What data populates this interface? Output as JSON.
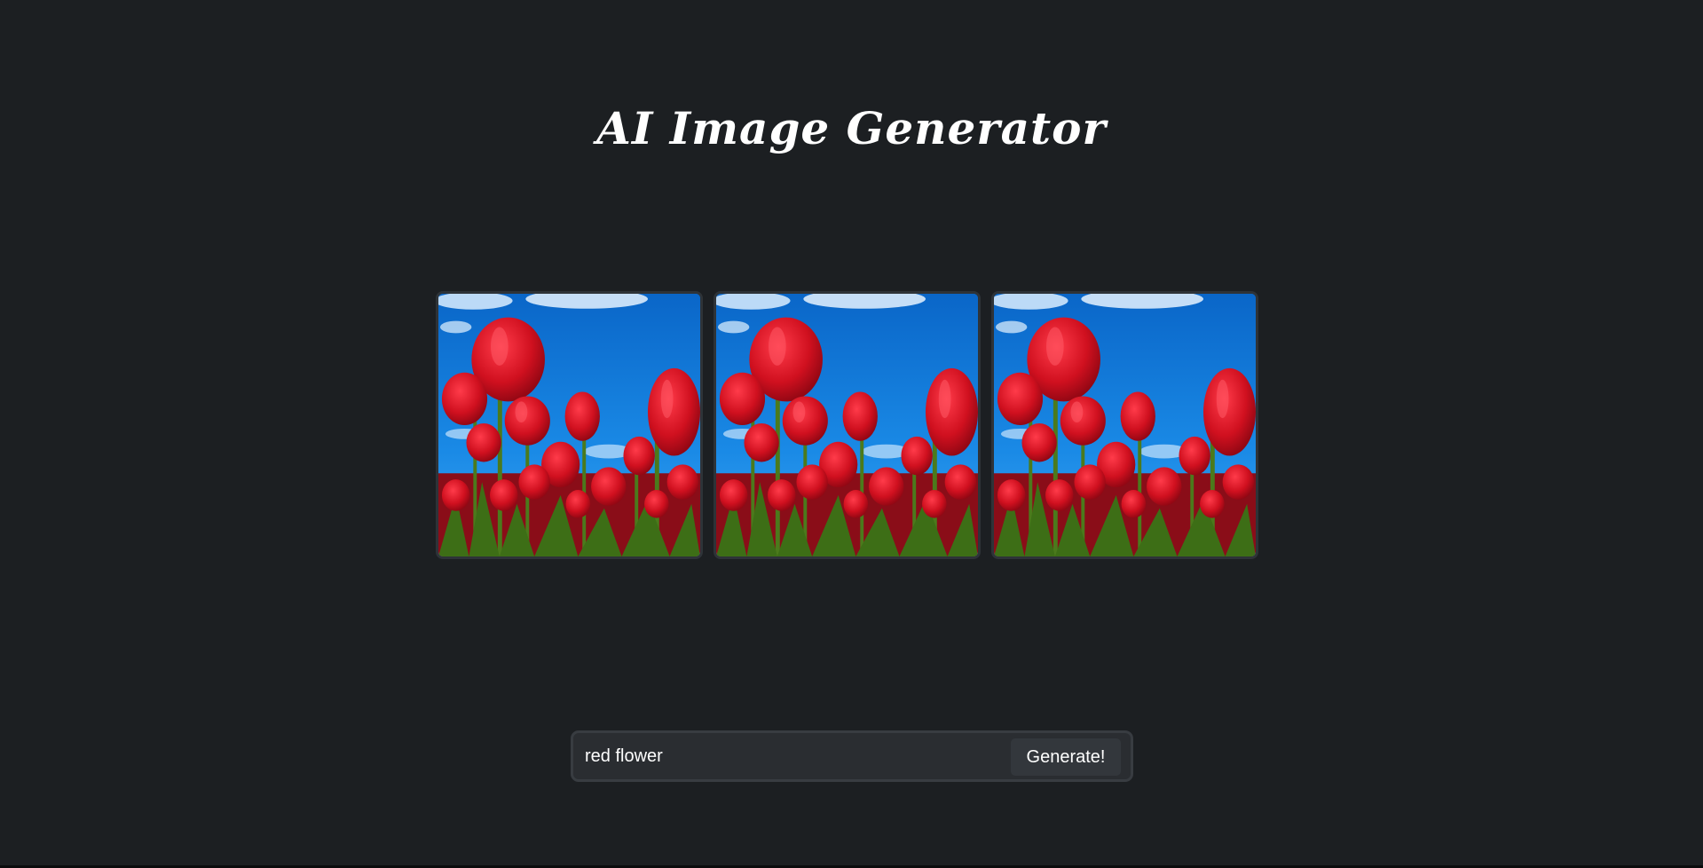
{
  "page": {
    "title": "AI Image Generator"
  },
  "gallery": {
    "images": [
      {
        "subject": "red tulips against blue sky"
      },
      {
        "subject": "red tulips against blue sky"
      },
      {
        "subject": "red tulips against blue sky"
      }
    ]
  },
  "prompt": {
    "value": "red flower",
    "button_label": "Generate!"
  },
  "colors": {
    "background": "#1c1f22",
    "panel": "#2a2d31",
    "button": "#33373c",
    "sky": "#1078d8",
    "tulip": "#d9142a"
  }
}
